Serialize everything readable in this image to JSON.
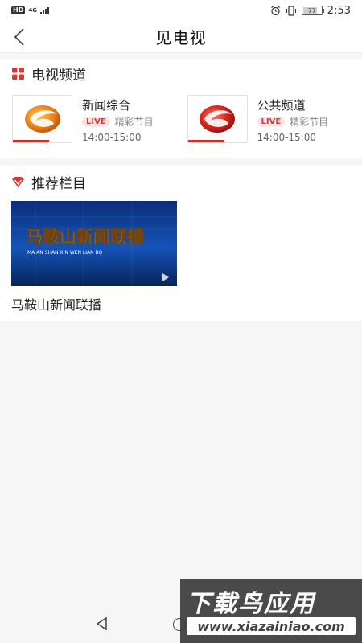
{
  "status_bar": {
    "hd": "HD",
    "network": "4G",
    "battery": "77",
    "time": "2:53"
  },
  "nav": {
    "title": "见电视"
  },
  "channels": {
    "section_title": "电视频道",
    "items": [
      {
        "name": "新闻综合",
        "live": "LIVE",
        "label": "精彩节目",
        "time": "14:00-15:00",
        "logo_color": "#e07b1a"
      },
      {
        "name": "公共频道",
        "live": "LIVE",
        "label": "精彩节目",
        "time": "14:00-15:00",
        "logo_color": "#d22a22"
      }
    ]
  },
  "recommended": {
    "section_title": "推荐栏目",
    "items": [
      {
        "title": "马鞍山新闻联播",
        "banner_text": "马鞍山新闻联播",
        "banner_sub": "MA AN SHAN XIN WEN LIAN BO"
      }
    ]
  },
  "watermark": {
    "main": "下载鸟应用",
    "url": "www.xiazainiao.com"
  },
  "colors": {
    "accent": "#d23b37",
    "live_bg": "#fde4e3"
  }
}
